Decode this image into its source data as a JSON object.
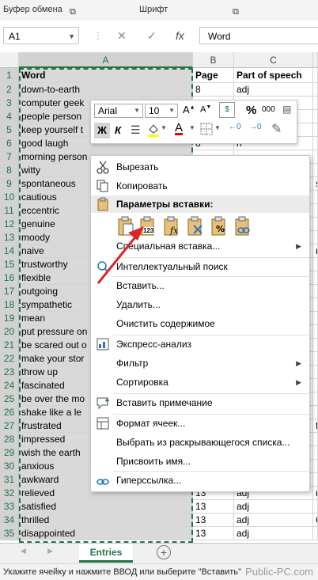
{
  "ribbon": {
    "clipboard_label": "Буфер обмена",
    "font_label": "Шрифт"
  },
  "formula_bar": {
    "name_box": "A1",
    "fx_label": "fx",
    "content": "Word"
  },
  "columns": [
    {
      "label": "A",
      "width": 220
    },
    {
      "label": "B",
      "width": 52
    },
    {
      "label": "C",
      "width": 100
    },
    {
      "label": "",
      "width": 6
    }
  ],
  "rows": [
    {
      "n": "1",
      "a": "Word",
      "b": "Page",
      "c": "Part of speech",
      "d": ""
    },
    {
      "n": "2",
      "a": "down-to-earth",
      "b": "8",
      "c": "adj",
      "d": ""
    },
    {
      "n": "3",
      "a": "computer geek",
      "b": "",
      "c": "",
      "d": ""
    },
    {
      "n": "4",
      "a": "people person",
      "b": "",
      "c": "",
      "d": ""
    },
    {
      "n": "5",
      "a": "keep yourself t",
      "b": "",
      "c": "",
      "d": ""
    },
    {
      "n": "6",
      "a": "good laugh",
      "b": "8",
      "c": "n",
      "d": ""
    },
    {
      "n": "7",
      "a": "morning person",
      "b": "",
      "c": "",
      "d": ""
    },
    {
      "n": "8",
      "a": "witty",
      "b": "",
      "c": "",
      "d": ""
    },
    {
      "n": "9",
      "a": "spontaneous",
      "b": "",
      "c": "",
      "d": "s"
    },
    {
      "n": "10",
      "a": "cautious",
      "b": "",
      "c": "",
      "d": ""
    },
    {
      "n": "11",
      "a": "eccentric",
      "b": "",
      "c": "",
      "d": ""
    },
    {
      "n": "12",
      "a": "genuine",
      "b": "",
      "c": "",
      "d": ""
    },
    {
      "n": "13",
      "a": "moody",
      "b": "",
      "c": "",
      "d": ""
    },
    {
      "n": "14",
      "a": "naive",
      "b": "",
      "c": "",
      "d": "r"
    },
    {
      "n": "15",
      "a": "trustworthy",
      "b": "",
      "c": "",
      "d": ""
    },
    {
      "n": "16",
      "a": "flexible",
      "b": "",
      "c": "",
      "d": ""
    },
    {
      "n": "17",
      "a": "outgoing",
      "b": "",
      "c": "",
      "d": ""
    },
    {
      "n": "18",
      "a": "sympathetic",
      "b": "",
      "c": "",
      "d": ""
    },
    {
      "n": "19",
      "a": "mean",
      "b": "",
      "c": "",
      "d": ""
    },
    {
      "n": "20",
      "a": "put pressure on",
      "b": "",
      "c": "",
      "d": ""
    },
    {
      "n": "21",
      "a": "be scared out o",
      "b": "",
      "c": "",
      "d": ""
    },
    {
      "n": "22",
      "a": "make your stor",
      "b": "",
      "c": "",
      "d": ""
    },
    {
      "n": "23",
      "a": "throw up",
      "b": "",
      "c": "",
      "d": ""
    },
    {
      "n": "24",
      "a": "fascinated",
      "b": "",
      "c": "",
      "d": ""
    },
    {
      "n": "25",
      "a": "be over the mo",
      "b": "",
      "c": "",
      "d": ""
    },
    {
      "n": "26",
      "a": "shake like a le",
      "b": "",
      "c": "",
      "d": ""
    },
    {
      "n": "27",
      "a": "frustrated",
      "b": "",
      "c": "",
      "d": "f"
    },
    {
      "n": "28",
      "a": "impressed",
      "b": "",
      "c": "",
      "d": ""
    },
    {
      "n": "29",
      "a": "wish the earth",
      "b": "",
      "c": "",
      "d": ""
    },
    {
      "n": "30",
      "a": "anxious",
      "b": "",
      "c": "",
      "d": ""
    },
    {
      "n": "31",
      "a": "awkward",
      "b": "",
      "c": "",
      "d": ""
    },
    {
      "n": "32",
      "a": "relieved",
      "b": "13",
      "c": "adj",
      "d": "r"
    },
    {
      "n": "33",
      "a": "satisfied",
      "b": "13",
      "c": "adj",
      "d": ""
    },
    {
      "n": "34",
      "a": "thrilled",
      "b": "13",
      "c": "adj",
      "d": "6"
    },
    {
      "n": "35",
      "a": "disappointed",
      "b": "13",
      "c": "adj",
      "d": ""
    }
  ],
  "mini_toolbar": {
    "font_name": "Arial",
    "font_size": "10",
    "bold": "Ж",
    "italic": "К",
    "percent": "%",
    "thousands": "000"
  },
  "context_menu": {
    "cut": "Вырезать",
    "copy": "Копировать",
    "paste_options_header": "Параметры вставки:",
    "paste_values_badge": "123",
    "paste_special": "Специальная вставка...",
    "smart_lookup": "Интеллектуальный поиск",
    "insert": "Вставить...",
    "delete": "Удалить...",
    "clear_contents": "Очистить содержимое",
    "quick_analysis": "Экспресс-анализ",
    "filter": "Фильтр",
    "sort": "Сортировка",
    "insert_comment": "Вставить примечание",
    "format_cells": "Формат ячеек...",
    "pick_from_list": "Выбрать из раскрывающегося списка...",
    "define_name": "Присвоить имя...",
    "hyperlink": "Гиперссылка..."
  },
  "sheet_tab": "Entries",
  "status_bar": "Укажите ячейку и нажмите ВВОД или выберите \"Вставить\"",
  "watermark": "Public-PC.com",
  "colors": {
    "accent": "#217346",
    "arrow": "#d9262b"
  }
}
